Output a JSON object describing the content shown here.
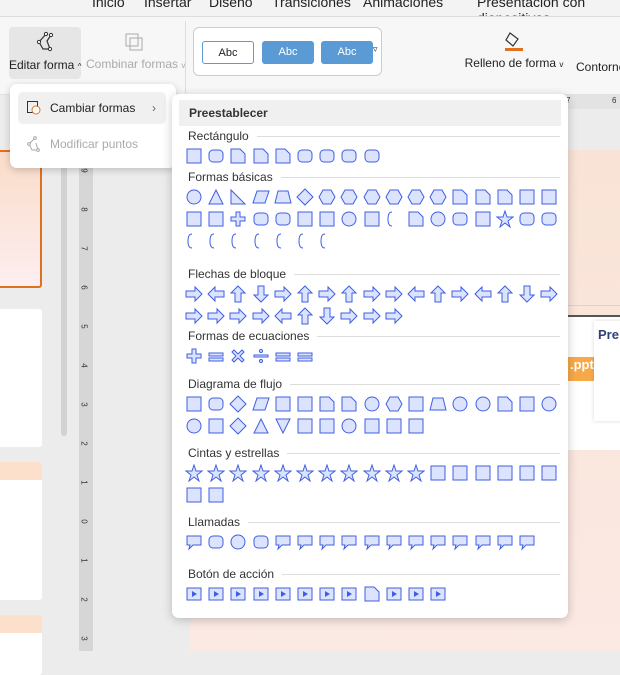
{
  "tabs": [
    "Inicio",
    "Insertar",
    "Diseño",
    "Transiciones",
    "Animaciones",
    "Presentación con diapositivas"
  ],
  "ribbon": {
    "edit_shape": "Editar forma",
    "combine_shapes": "Combinar formas",
    "styles": [
      "Abc",
      "Abc",
      "Abc"
    ],
    "shape_fill": "Relleno de forma",
    "outline": "Contorno"
  },
  "menu": {
    "change_shapes": "Cambiar formas",
    "edit_points": "Modificar puntos"
  },
  "panel": {
    "title": "Preestablecer",
    "sections": [
      {
        "label": "Rectángulo",
        "rows": [
          [
            "rect",
            "round-rect",
            "snip1",
            "snip2",
            "snip-diag",
            "snip-round",
            "round1",
            "round2",
            "round-diag"
          ]
        ]
      },
      {
        "label": "Formas básicas",
        "rows": [
          [
            "circle",
            "triangle",
            "right-triangle",
            "parallelogram",
            "trapezoid",
            "diamond",
            "pentagon",
            "hexagon",
            "heptagon",
            "octagon",
            "decagon",
            "dodecagon",
            "pie",
            "chord",
            "teardrop",
            "frame",
            "half-frame"
          ],
          [
            "corner",
            "diag-stripe",
            "cross",
            "plaque",
            "can",
            "cube",
            "bevel",
            "donut",
            "no-symbol",
            "block-arc",
            "folded-corner",
            "smiley",
            "heart",
            "lightning",
            "sun",
            "moon",
            "cloud"
          ],
          [
            "arc",
            "bracket-pair",
            "brace-pair",
            "left-bracket",
            "right-bracket",
            "left-brace",
            "right-brace"
          ]
        ]
      },
      {
        "label": "Flechas de bloque",
        "rows": [
          [
            "right-arrow",
            "left-arrow",
            "up-arrow",
            "down-arrow",
            "left-right-arrow",
            "up-down-arrow",
            "quad-arrow",
            "left-right-up-arrow",
            "bent-arrow",
            "u-turn-arrow",
            "left-up-arrow",
            "bent-up-arrow",
            "curved-right-arrow",
            "curved-left-arrow",
            "curved-up-arrow",
            "curved-down-arrow",
            "striped-right-arrow"
          ],
          [
            "notched-right-arrow",
            "pentagon-arrow",
            "chevron",
            "right-arrow-callout",
            "left-arrow-callout",
            "up-arrow-callout",
            "down-arrow-callout",
            "left-right-arrow-callout",
            "quad-arrow-callout",
            "circular-arrow"
          ]
        ]
      },
      {
        "label": "Formas de ecuaciones",
        "rows": [
          [
            "plus",
            "minus",
            "multiply",
            "divide",
            "equal",
            "not-equal"
          ]
        ]
      },
      {
        "label": "Diagrama de flujo",
        "rows": [
          [
            "process",
            "alternate-process",
            "decision",
            "data",
            "predefined-process",
            "internal-storage",
            "document",
            "multidocument",
            "terminator",
            "preparation",
            "manual-input",
            "manual-operation",
            "connector",
            "offpage-connector",
            "card",
            "punched-tape",
            "summing-junction"
          ],
          [
            "or",
            "collate",
            "sort",
            "extract",
            "merge",
            "stored-data",
            "delay",
            "sequential-storage",
            "magnetic-disk",
            "direct-access-storage",
            "display"
          ]
        ]
      },
      {
        "label": "Cintas y estrellas",
        "rows": [
          [
            "explosion1",
            "star4",
            "star5",
            "star6",
            "star7",
            "star8",
            "star10",
            "star12",
            "star16",
            "star24",
            "star32",
            "ribbon-up",
            "ribbon-down",
            "curved-ribbon-up",
            "curved-ribbon-down",
            "vertical-scroll",
            "horizontal-scroll"
          ],
          [
            "wave",
            "double-wave"
          ]
        ]
      },
      {
        "label": "Llamadas",
        "rows": [
          [
            "rect-callout",
            "round-rect-callout",
            "oval-callout",
            "cloud-callout",
            "line-callout1",
            "line-callout2",
            "line-callout3",
            "line-callout1-accent",
            "line-callout2-accent",
            "line-callout3-accent",
            "line-callout1-border",
            "line-callout2-border",
            "line-callout3-border",
            "line-callout1-no-border",
            "line-callout2-no-border",
            "line-callout3-no-border"
          ]
        ]
      },
      {
        "label": "Botón de acción",
        "rows": [
          [
            "action-back",
            "action-forward",
            "action-beginning",
            "action-end",
            "action-home",
            "action-information",
            "action-return",
            "action-movie",
            "action-document",
            "action-sound",
            "action-help",
            "action-blank"
          ]
        ]
      }
    ]
  },
  "rulers": {
    "vertical": [
      "9",
      "8",
      "7",
      "6",
      "5",
      "4",
      "3",
      "2",
      "1",
      "0",
      "1",
      "2",
      "3"
    ],
    "horizontal": [
      "7",
      "6"
    ]
  },
  "colors": {
    "accent": "#e0711f",
    "shape_stroke": "#3f5fe0",
    "shape_fill": "#dbe3ff",
    "style_blue": "#5b9bd5"
  }
}
